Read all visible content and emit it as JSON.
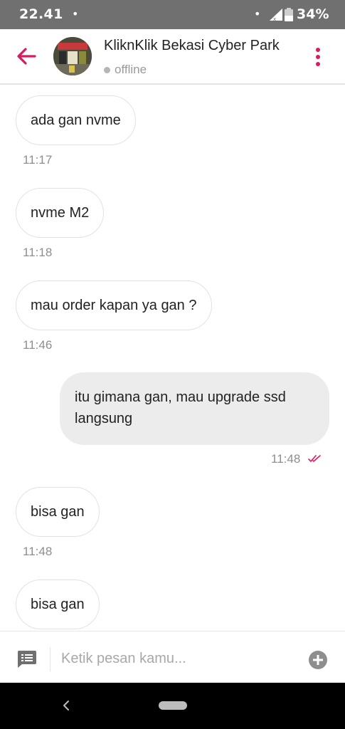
{
  "status_bar": {
    "time": "22.41",
    "battery": "34%",
    "icons": [
      "notification-dot-icon",
      "signal-icon",
      "battery-icon"
    ]
  },
  "header": {
    "shop_name": "KliknKlik Bekasi Cyber Park",
    "status": "offline",
    "icons": [
      "back-arrow-icon",
      "shop-avatar",
      "more-vert-icon"
    ]
  },
  "messages": [
    {
      "direction": "in",
      "text": "ada gan nvme",
      "time": "11:17"
    },
    {
      "direction": "in",
      "text": "nvme M2",
      "time": "11:18"
    },
    {
      "direction": "in",
      "text": "mau order kapan ya gan ?",
      "time": "11:46"
    },
    {
      "direction": "out",
      "text_line1": "itu gimana gan, mau upgrade ssd",
      "text_line2": "langsung",
      "time": "11:48",
      "read_icon": "double-check-icon"
    },
    {
      "direction": "in",
      "text": "bisa gan",
      "time": "11:48"
    },
    {
      "direction": "in",
      "text": "bisa gan",
      "time": ""
    }
  ],
  "input_bar": {
    "placeholder": "Ketik pesan kamu...",
    "icons": [
      "template-message-icon",
      "add-circle-icon"
    ]
  },
  "colors": {
    "accent": "#d81b60",
    "status_bar": "#707070",
    "outgoing_bubble": "#ececec",
    "incoming_border": "#e2e2e2",
    "timestamp": "#8e8e8e"
  }
}
